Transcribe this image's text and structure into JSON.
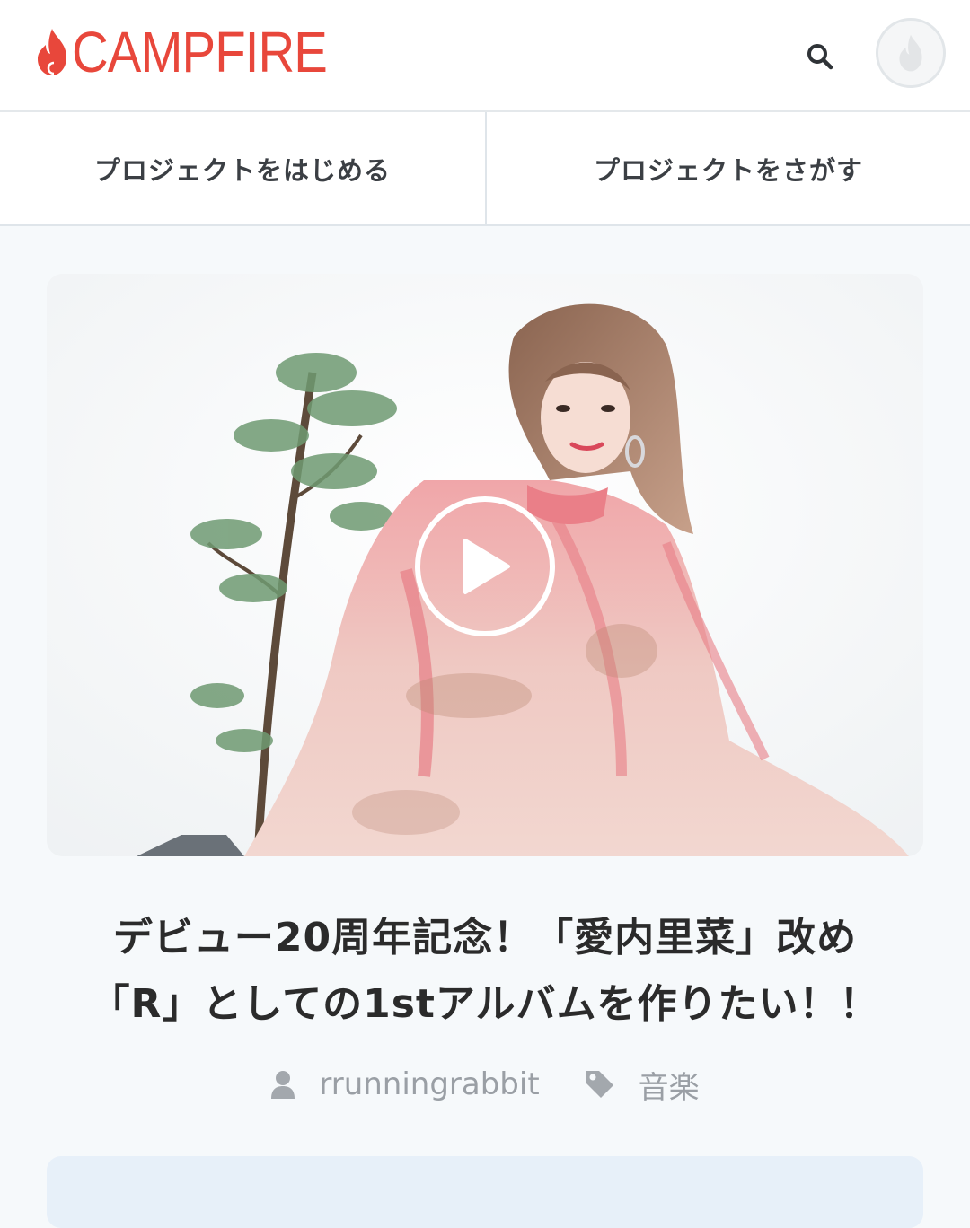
{
  "header": {
    "logo_text": "CAMPFIRE",
    "brand_color": "#e8473b",
    "search_icon": "search-icon",
    "avatar_icon": "flame-icon"
  },
  "nav": {
    "start_label": "プロジェクトをはじめる",
    "find_label": "プロジェクトをさがす"
  },
  "hero": {
    "play_icon": "play-icon"
  },
  "project": {
    "title_line1": "デビュー20周年記念！「愛内里菜」改め",
    "title_line2": "「R」としての1stアルバムを作りたい！！",
    "author": "rrunningrabbit",
    "category": "音楽"
  }
}
